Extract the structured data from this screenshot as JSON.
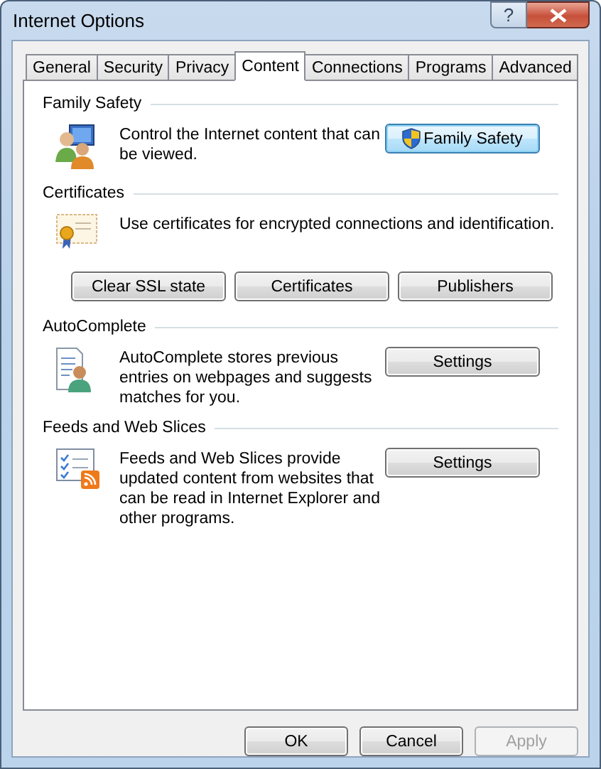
{
  "window": {
    "title": "Internet Options",
    "help": "?"
  },
  "tabs": [
    {
      "label": "General",
      "selected": false
    },
    {
      "label": "Security",
      "selected": false
    },
    {
      "label": "Privacy",
      "selected": false
    },
    {
      "label": "Content",
      "selected": true
    },
    {
      "label": "Connections",
      "selected": false
    },
    {
      "label": "Programs",
      "selected": false
    },
    {
      "label": "Advanced",
      "selected": false
    }
  ],
  "sections": [
    {
      "title": "Family Safety",
      "kind": "family",
      "description": "Control the Internet content that can be viewed.",
      "side_button": {
        "label": "Family Safety",
        "focused": true,
        "shield": true
      }
    },
    {
      "title": "Certificates",
      "kind": "certificate",
      "description": "Use certificates for encrypted connections and identification.",
      "buttons": [
        "Clear SSL state",
        "Certificates",
        "Publishers"
      ]
    },
    {
      "title": "AutoComplete",
      "kind": "autocomplete",
      "description": "AutoComplete stores previous entries on webpages and suggests matches for you.",
      "side_button": {
        "label": "Settings",
        "focused": false,
        "shield": false
      }
    },
    {
      "title": "Feeds and Web Slices",
      "kind": "feeds",
      "description": "Feeds and Web Slices provide updated content from websites that can be read in Internet Explorer and other programs.",
      "side_button": {
        "label": "Settings",
        "focused": false,
        "shield": false
      }
    }
  ],
  "footer_buttons": [
    {
      "label": "OK",
      "disabled": false
    },
    {
      "label": "Cancel",
      "disabled": false
    },
    {
      "label": "Apply",
      "disabled": true
    }
  ]
}
